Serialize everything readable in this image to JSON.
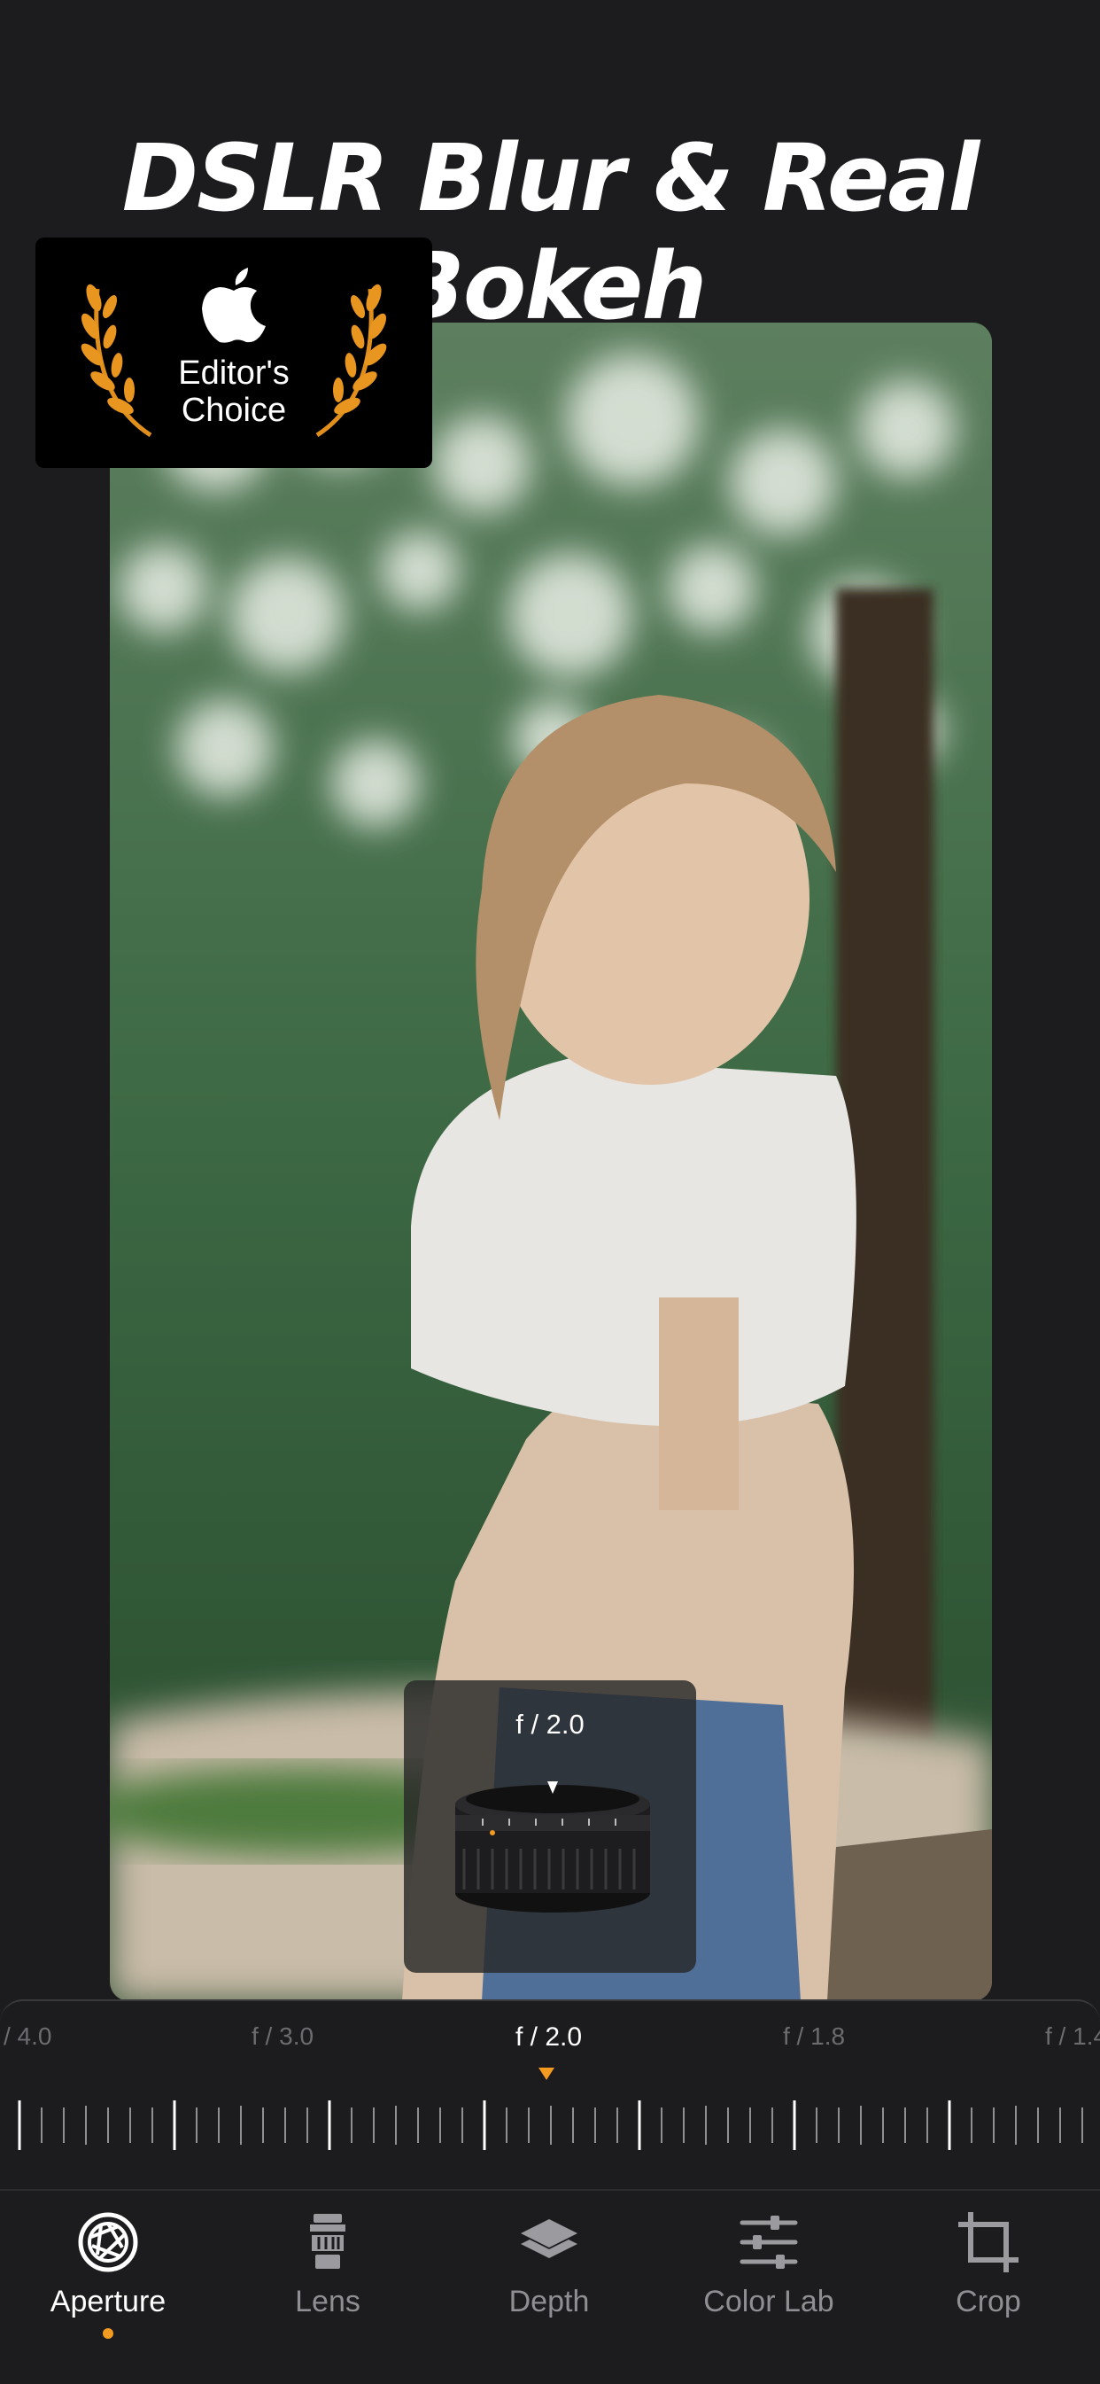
{
  "headline": "DSLR Blur & Real Bokeh",
  "badge": {
    "line1": "Editor's",
    "line2": "Choice",
    "icon": "apple-logo-icon",
    "accent": "#f29b20"
  },
  "lens_popup": {
    "value": "f / 2.0",
    "icon": "camera-lens-icon"
  },
  "aperture_dial": {
    "labels": [
      "/ 4.0",
      "f / 3.0",
      "f / 2.0",
      "f / 1.8",
      "f / 1.4"
    ],
    "selected": "f / 2.0",
    "pointer_color": "#f29b20"
  },
  "toolbar": {
    "items": [
      {
        "label": "Aperture",
        "icon": "aperture-icon",
        "active": true
      },
      {
        "label": "Lens",
        "icon": "lens-icon",
        "active": false
      },
      {
        "label": "Depth",
        "icon": "layers-icon",
        "active": false
      },
      {
        "label": "Color Lab",
        "icon": "sliders-icon",
        "active": false
      },
      {
        "label": "Crop",
        "icon": "crop-icon",
        "active": false
      }
    ],
    "active_color": "#f29b20"
  }
}
